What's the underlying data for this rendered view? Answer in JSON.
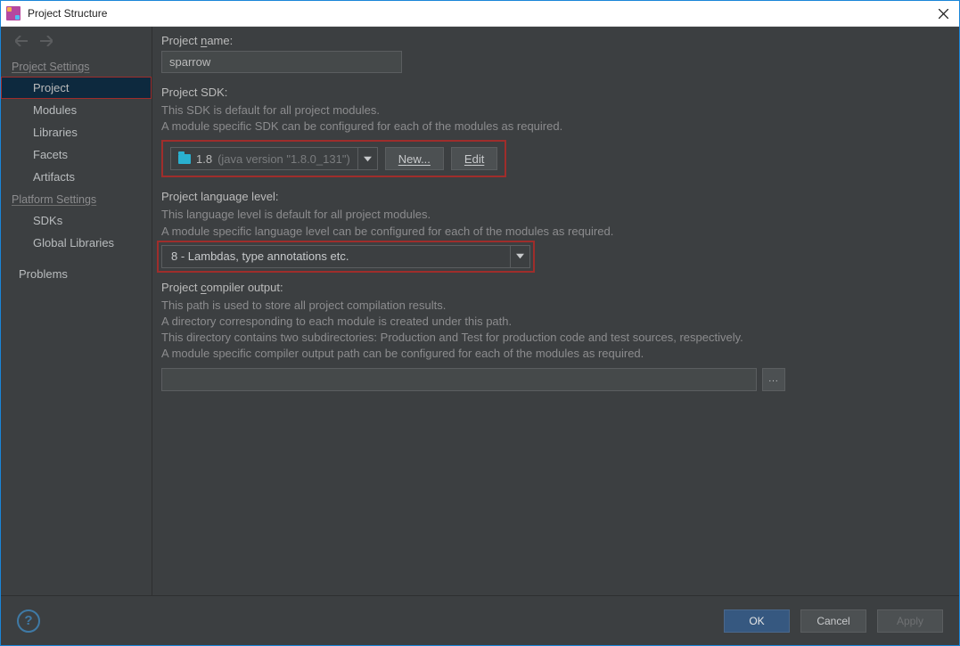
{
  "window": {
    "title": "Project Structure"
  },
  "sidebar": {
    "project_settings_header": "Project Settings",
    "platform_settings_header": "Platform Settings",
    "items_project": [
      {
        "label": "Project"
      },
      {
        "label": "Modules"
      },
      {
        "label": "Libraries"
      },
      {
        "label": "Facets"
      },
      {
        "label": "Artifacts"
      }
    ],
    "items_platform": [
      {
        "label": "SDKs"
      },
      {
        "label": "Global Libraries"
      }
    ],
    "problems_label": "Problems"
  },
  "project_name": {
    "label_prefix": "Project ",
    "label_underlined": "n",
    "label_suffix": "ame:",
    "value": "sparrow"
  },
  "sdk": {
    "label": "Project SDK:",
    "desc1": "This SDK is default for all project modules.",
    "desc2": "A module specific SDK can be configured for each of the modules as required.",
    "selected_name": "1.8",
    "selected_detail": "(java version \"1.8.0_131\")",
    "new_prefix": "N",
    "new_suffix": "ew...",
    "edit_prefix": "E",
    "edit_suffix": "dit"
  },
  "lang": {
    "label": "Project language level:",
    "desc1": "This language level is default for all project modules.",
    "desc2": "A module specific language level can be configured for each of the modules as required.",
    "selected": "8 - Lambdas, type annotations etc."
  },
  "output": {
    "label_prefix": "Project ",
    "label_underlined": "c",
    "label_suffix": "ompiler output:",
    "desc1": "This path is used to store all project compilation results.",
    "desc2": "A directory corresponding to each module is created under this path.",
    "desc3": "This directory contains two subdirectories: Production and Test for production code and test sources, respectively.",
    "desc4": "A module specific compiler output path can be configured for each of the modules as required.",
    "value": "",
    "browse": "..."
  },
  "footer": {
    "ok": "OK",
    "cancel": "Cancel",
    "apply": "Apply"
  }
}
